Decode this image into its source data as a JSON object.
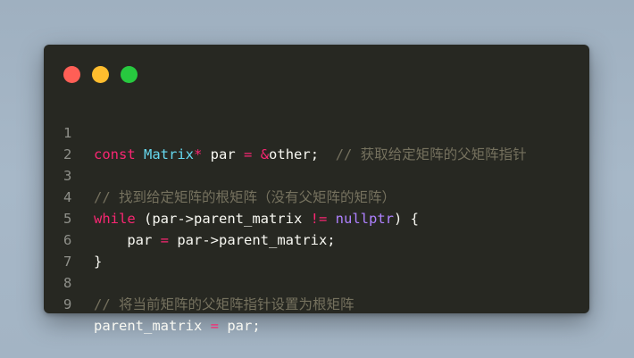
{
  "window": {
    "buttons": [
      "close",
      "minimize",
      "maximize"
    ],
    "colors": {
      "close": "#ff5f56",
      "minimize": "#ffbd2e",
      "maximize": "#27c93f"
    }
  },
  "code": {
    "language": "cpp",
    "line_numbers": [
      "1",
      "2",
      "3",
      "4",
      "5",
      "6",
      "7",
      "8",
      "9"
    ],
    "tokens": {
      "l1_const": "const",
      "l1_type": " Matrix",
      "l1_star": "*",
      "l1_var": " par ",
      "l1_eq": "=",
      "l1_amp": " &",
      "l1_other": "other;  ",
      "l1_comment": "// 获取给定矩阵的父矩阵指针",
      "l3_comment": "// 找到给定矩阵的根矩阵（没有父矩阵的矩阵）",
      "l4_while": "while",
      "l4_cond": " (par->parent_matrix ",
      "l4_ne": "!=",
      "l4_sp": " ",
      "l4_nullptr": "nullptr",
      "l4_end": ") {",
      "l5_a": "    par ",
      "l5_eq": "=",
      "l5_b": " par->parent_matrix;",
      "l6_brace": "}",
      "l8_comment": "// 将当前矩阵的父矩阵指针设置为根矩阵",
      "l9_a": "parent_matrix ",
      "l9_eq": "=",
      "l9_b": " par;"
    }
  }
}
